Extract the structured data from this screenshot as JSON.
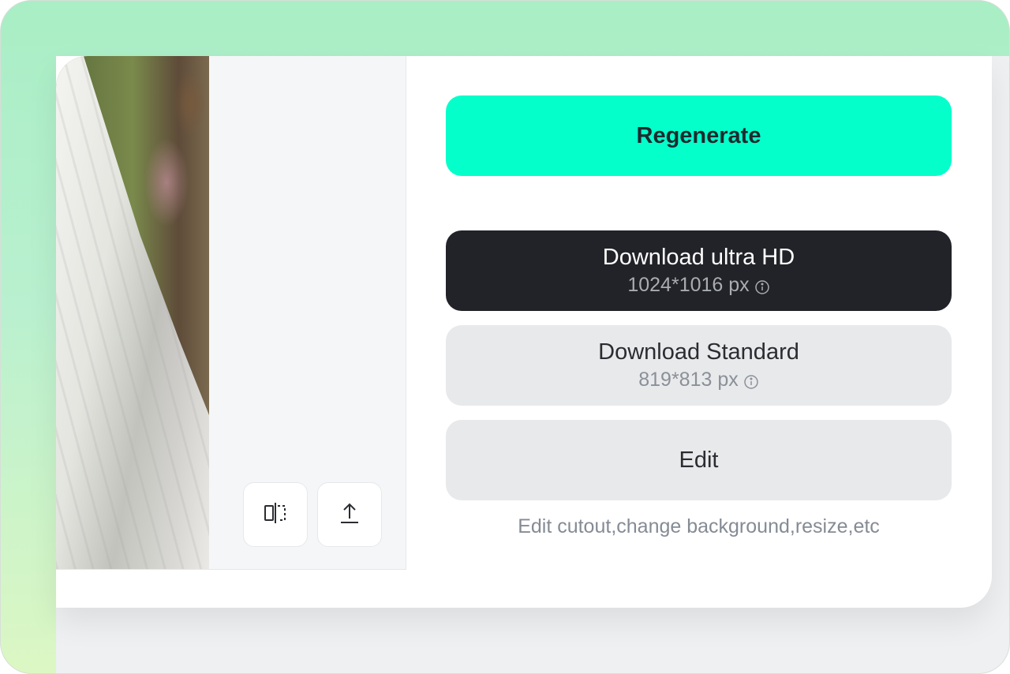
{
  "actions": {
    "regenerate_label": "Regenerate",
    "download_hd": {
      "label": "Download ultra HD",
      "size": "1024*1016 px"
    },
    "download_standard": {
      "label": "Download Standard",
      "size": "819*813 px"
    },
    "edit_label": "Edit",
    "edit_hint": "Edit cutout,change background,resize,etc"
  },
  "tools": {
    "compare_icon": "split-compare-icon",
    "upload_icon": "upload-icon"
  },
  "colors": {
    "accent": "#05ffcb",
    "dark_button": "#222328",
    "light_button": "#e8e9eb"
  }
}
